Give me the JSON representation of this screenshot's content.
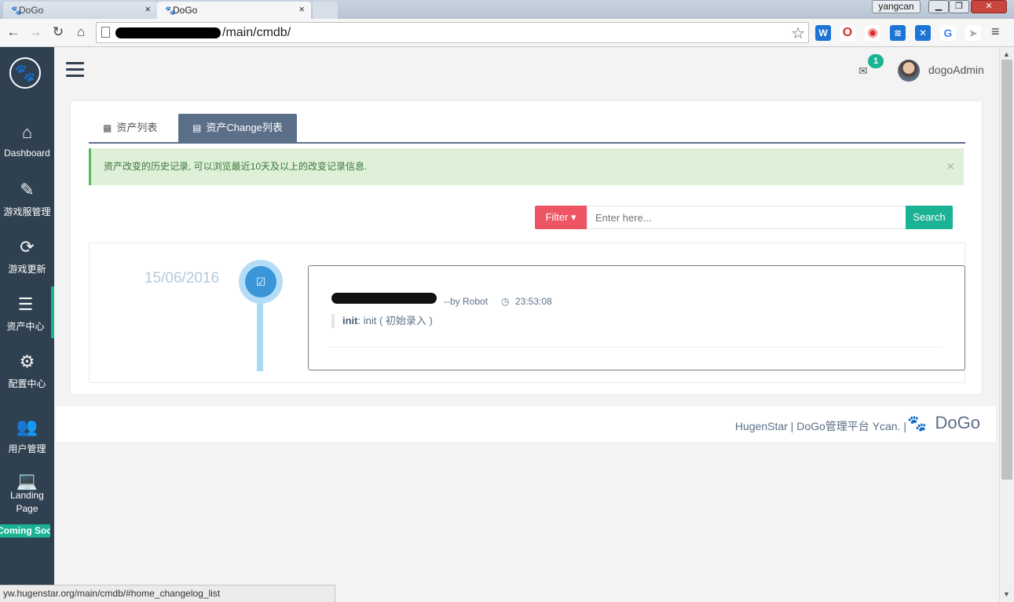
{
  "browser": {
    "tabs": [
      {
        "title": "DoGo",
        "active": false
      },
      {
        "title": "DoGo",
        "active": true
      }
    ],
    "profile_name": "yangcan",
    "url_suffix": "/main/cmdb/",
    "status_url": "yw.hugenstar.org/main/cmdb/#home_changelog_list"
  },
  "sidebar": {
    "items": [
      {
        "label": "Dashboard",
        "icon": "home-icon"
      },
      {
        "label": "游戏服管理",
        "icon": "edit-icon"
      },
      {
        "label": "游戏更新",
        "icon": "refresh-icon"
      },
      {
        "label": "资产中心",
        "icon": "database-icon",
        "active": true
      },
      {
        "label": "配置中心",
        "icon": "cogs-icon"
      },
      {
        "label": "用户管理",
        "icon": "users-icon"
      },
      {
        "label": "Landing Page",
        "icon": "laptop-icon"
      }
    ],
    "coming_soon": "Coming Soon"
  },
  "header": {
    "mail_count": "1",
    "user": "dogoAdmin"
  },
  "tabs": [
    {
      "label": "资产列表",
      "active": false
    },
    {
      "label": "资产Change列表",
      "active": true
    }
  ],
  "alert": {
    "text": "资产改变的历史记录, 可以浏览最近10天及以上的改变记录信息.",
    "close": "×"
  },
  "search": {
    "filter_label": "Filter",
    "placeholder": "Enter here...",
    "button_label": "Search"
  },
  "timeline": {
    "date": "15/06/2016",
    "entries": [
      {
        "by": "--by Robot",
        "time": "23:53:08",
        "field": "init",
        "detail": ": init ( 初始录入 )"
      }
    ]
  },
  "footer": {
    "text": "HugenStar | DoGo管理平台 Ycan. |",
    "brand": "DoGo"
  },
  "colors": {
    "sidebar_bg": "#2f4050",
    "accent_green": "#1ab394",
    "filter_red": "#ed5565",
    "tab_active": "#5c6f89",
    "timeline_blue": "#3a96d8"
  }
}
